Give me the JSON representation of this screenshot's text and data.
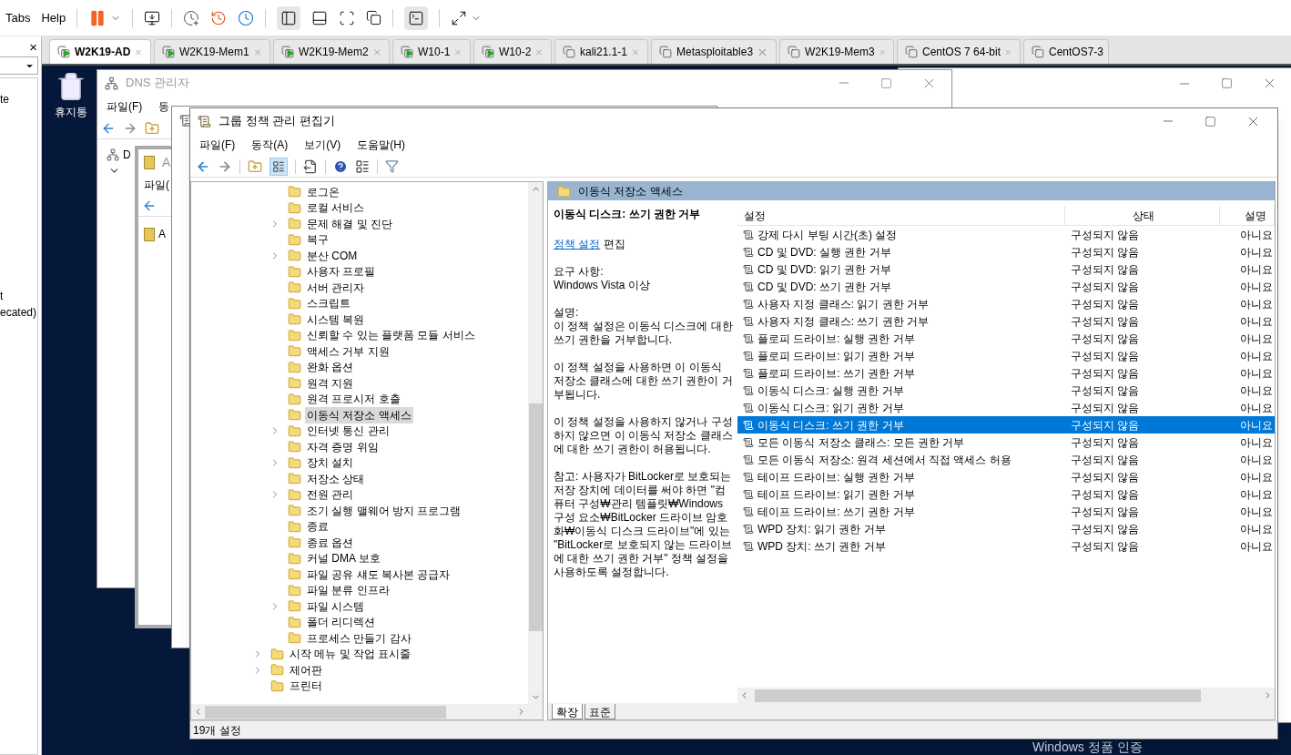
{
  "vm_menu": [
    "Tabs",
    "Help"
  ],
  "left_panel": {
    "close": "×",
    "fragments": [
      "te",
      "t",
      "ecated)"
    ]
  },
  "vm_tabs": [
    {
      "label": "W2K19-AD",
      "selected": true,
      "running": true
    },
    {
      "label": "W2K19-Mem1",
      "selected": false,
      "running": true
    },
    {
      "label": "W2K19-Mem2",
      "selected": false,
      "running": true
    },
    {
      "label": "W10-1",
      "selected": false,
      "running": true
    },
    {
      "label": "W10-2",
      "selected": false,
      "running": true
    },
    {
      "label": "kali21.1-1",
      "selected": false,
      "running": false
    },
    {
      "label": "Metasploitable3",
      "selected": false,
      "running": false
    },
    {
      "label": "W2K19-Mem3",
      "selected": false,
      "running": false
    },
    {
      "label": "CentOS 7 64-bit",
      "selected": false,
      "running": false
    },
    {
      "label": "CentOS7-3",
      "selected": false,
      "running": false
    }
  ],
  "desktop": {
    "recycle_bin": "휴지통",
    "activation_notice": "Windows 정품 인증"
  },
  "dns_window": {
    "title": "DNS 관리자",
    "menus": [
      "파일(F)",
      "동"
    ],
    "tree_label": "D"
  },
  "ad_window": {
    "title": "A",
    "menu": "파일(",
    "tree_label": "A"
  },
  "gpe_window": {
    "title": "그룹 정책 관리 편집기",
    "menus": [
      "파일(F)",
      "동작(A)",
      "보기(V)",
      "도움말(H)"
    ],
    "tree": [
      {
        "children": [
          {
            "label": "로그온",
            "expandable": false,
            "selected": false
          },
          {
            "label": "로컬 서비스",
            "expandable": false,
            "selected": false
          },
          {
            "label": "문제 해결 및 진단",
            "expandable": true,
            "selected": false
          },
          {
            "label": "복구",
            "expandable": false,
            "selected": false
          },
          {
            "label": "분산 COM",
            "expandable": true,
            "selected": false
          },
          {
            "label": "사용자 프로필",
            "expandable": false,
            "selected": false
          },
          {
            "label": "서버 관리자",
            "expandable": false,
            "selected": false
          },
          {
            "label": "스크립트",
            "expandable": false,
            "selected": false
          },
          {
            "label": "시스템 복원",
            "expandable": false,
            "selected": false
          },
          {
            "label": "신뢰할 수 있는 플랫폼 모듈 서비스",
            "expandable": false,
            "selected": false
          },
          {
            "label": "액세스 거부 지원",
            "expandable": false,
            "selected": false
          },
          {
            "label": "완화 옵션",
            "expandable": false,
            "selected": false
          },
          {
            "label": "원격 지원",
            "expandable": false,
            "selected": false
          },
          {
            "label": "원격 프로시저 호출",
            "expandable": false,
            "selected": false
          },
          {
            "label": "이동식 저장소 액세스",
            "expandable": false,
            "selected": true
          },
          {
            "label": "인터넷 통신 관리",
            "expandable": true,
            "selected": false
          },
          {
            "label": "자격 증명 위임",
            "expandable": false,
            "selected": false
          },
          {
            "label": "장치 설치",
            "expandable": true,
            "selected": false
          },
          {
            "label": "저장소 상태",
            "expandable": false,
            "selected": false
          },
          {
            "label": "전원 관리",
            "expandable": true,
            "selected": false
          },
          {
            "label": "조기 실행 맬웨어 방지 프로그램",
            "expandable": false,
            "selected": false
          },
          {
            "label": "종료",
            "expandable": false,
            "selected": false
          },
          {
            "label": "종료 옵션",
            "expandable": false,
            "selected": false
          },
          {
            "label": "커널 DMA 보호",
            "expandable": false,
            "selected": false
          },
          {
            "label": "파일 공유 섀도 복사본 공급자",
            "expandable": false,
            "selected": false
          },
          {
            "label": "파일 분류 인프라",
            "expandable": false,
            "selected": false
          },
          {
            "label": "파일 시스템",
            "expandable": true,
            "selected": false
          },
          {
            "label": "폴더 리디렉션",
            "expandable": false,
            "selected": false
          },
          {
            "label": "프로세스 만들기 감사",
            "expandable": false,
            "selected": false
          }
        ]
      },
      {
        "label": "시작 메뉴 및 작업 표시줄",
        "expandable": true,
        "selected": false
      },
      {
        "label": "제어판",
        "expandable": true,
        "selected": false
      },
      {
        "label": "프린터",
        "expandable": false,
        "selected": false
      }
    ],
    "detail_header": "이동식 저장소 액세스",
    "description": {
      "title": "이동식 디스크: 쓰기 권한 거부",
      "link": "정책 설정",
      "link_suffix": "편집",
      "requirements_label": "요구 사항:",
      "requirements": "Windows Vista 이상",
      "description_label": "설명:",
      "paragraphs": [
        "이 정책 설정은 이동식 디스크에 대한 쓰기 권한을 거부합니다.",
        "이 정책 설정을 사용하면 이 이동식 저장소 클래스에 대한 쓰기 권한이 거부됩니다.",
        "이 정책 설정을 사용하지 않거나 구성하지 않으면 이 이동식 저장소 클래스에 대한 쓰기 권한이 허용됩니다.",
        "참고: 사용자가 BitLocker로 보호되는 저장 장치에 데이터를 써야 하면 \"컴퓨터 구성₩관리 템플릿₩Windows 구성 요소₩BitLocker 드라이브 암호화₩이동식 디스크 드라이브\"에 있는 \"BitLocker로 보호되지 않는 드라이브에 대한 쓰기 권한 거부\" 정책 설정을 사용하도록 설정합니다."
      ]
    },
    "columns": [
      "설정",
      "상태",
      "설명"
    ],
    "rows": [
      {
        "setting": "강제 다시 부팅 시간(초) 설정",
        "state": "구성되지 않음",
        "comment": "아니요",
        "selected": false
      },
      {
        "setting": "CD 및 DVD: 실행 권한 거부",
        "state": "구성되지 않음",
        "comment": "아니요",
        "selected": false
      },
      {
        "setting": "CD 및 DVD: 읽기 권한 거부",
        "state": "구성되지 않음",
        "comment": "아니요",
        "selected": false
      },
      {
        "setting": "CD 및 DVD: 쓰기 권한 거부",
        "state": "구성되지 않음",
        "comment": "아니요",
        "selected": false
      },
      {
        "setting": "사용자 지정 클래스: 읽기 권한 거부",
        "state": "구성되지 않음",
        "comment": "아니요",
        "selected": false
      },
      {
        "setting": "사용자 지정 클래스: 쓰기 권한 거부",
        "state": "구성되지 않음",
        "comment": "아니요",
        "selected": false
      },
      {
        "setting": "플로피 드라이브: 실행 권한 거부",
        "state": "구성되지 않음",
        "comment": "아니요",
        "selected": false
      },
      {
        "setting": "플로피 드라이브: 읽기 권한 거부",
        "state": "구성되지 않음",
        "comment": "아니요",
        "selected": false
      },
      {
        "setting": "플로피 드라이브: 쓰기 권한 거부",
        "state": "구성되지 않음",
        "comment": "아니요",
        "selected": false
      },
      {
        "setting": "이동식 디스크: 실행 권한 거부",
        "state": "구성되지 않음",
        "comment": "아니요",
        "selected": false
      },
      {
        "setting": "이동식 디스크: 읽기 권한 거부",
        "state": "구성되지 않음",
        "comment": "아니요",
        "selected": false
      },
      {
        "setting": "이동식 디스크: 쓰기 권한 거부",
        "state": "구성되지 않음",
        "comment": "아니요",
        "selected": true
      },
      {
        "setting": "모든 이동식 저장소 클래스: 모든 권한 거부",
        "state": "구성되지 않음",
        "comment": "아니요",
        "selected": false
      },
      {
        "setting": "모든 이동식 저장소: 원격 세션에서 직접 액세스 허용",
        "state": "구성되지 않음",
        "comment": "아니요",
        "selected": false
      },
      {
        "setting": "테이프 드라이브: 실행 권한 거부",
        "state": "구성되지 않음",
        "comment": "아니요",
        "selected": false
      },
      {
        "setting": "테이프 드라이브: 읽기 권한 거부",
        "state": "구성되지 않음",
        "comment": "아니요",
        "selected": false
      },
      {
        "setting": "테이프 드라이브: 쓰기 권한 거부",
        "state": "구성되지 않음",
        "comment": "아니요",
        "selected": false
      },
      {
        "setting": "WPD 장치: 읽기 권한 거부",
        "state": "구성되지 않음",
        "comment": "아니요",
        "selected": false
      },
      {
        "setting": "WPD 장치: 쓰기 권한 거부",
        "state": "구성되지 않음",
        "comment": "아니요",
        "selected": false
      }
    ],
    "view_tabs": [
      {
        "label": "확장",
        "selected": true
      },
      {
        "label": "표준",
        "selected": false
      }
    ],
    "status_bar": "19개 설정"
  }
}
